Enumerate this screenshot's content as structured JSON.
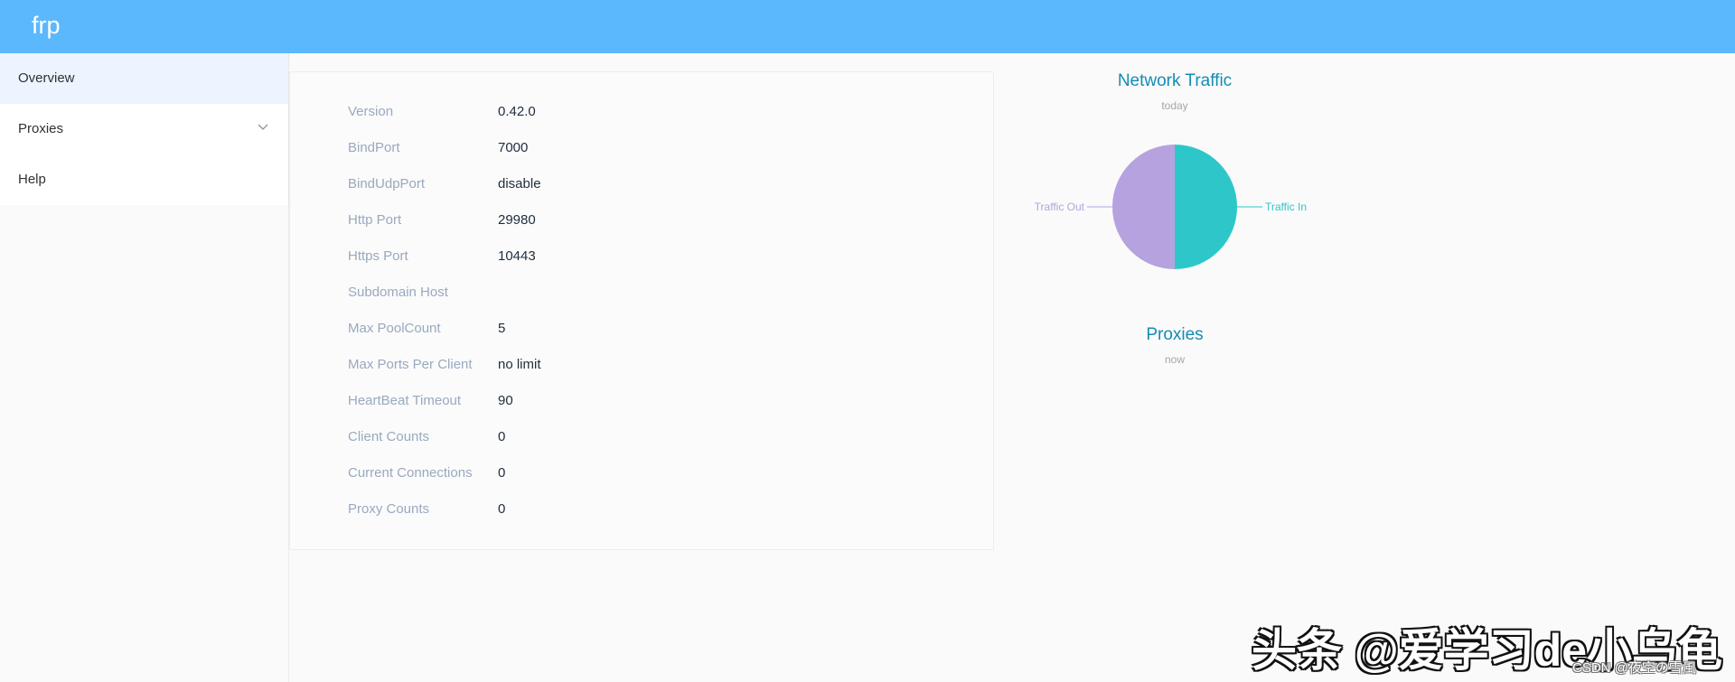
{
  "app": {
    "brand": "frp"
  },
  "sidebar": {
    "items": [
      {
        "label": "Overview",
        "active": true
      },
      {
        "label": "Proxies",
        "has_submenu": true
      },
      {
        "label": "Help"
      }
    ]
  },
  "server_info": [
    {
      "label": "Version",
      "value": "0.42.0"
    },
    {
      "label": "BindPort",
      "value": "7000"
    },
    {
      "label": "BindUdpPort",
      "value": "disable"
    },
    {
      "label": "Http Port",
      "value": "29980"
    },
    {
      "label": "Https Port",
      "value": "10443"
    },
    {
      "label": "Subdomain Host",
      "value": ""
    },
    {
      "label": "Max PoolCount",
      "value": "5"
    },
    {
      "label": "Max Ports Per Client",
      "value": "no limit"
    },
    {
      "label": "HeartBeat Timeout",
      "value": "90"
    },
    {
      "label": "Client Counts",
      "value": "0"
    },
    {
      "label": "Current Connections",
      "value": "0"
    },
    {
      "label": "Proxy Counts",
      "value": "0"
    }
  ],
  "traffic_chart": {
    "title": "Network Traffic",
    "subtitle": "today"
  },
  "proxies_chart": {
    "title": "Proxies",
    "subtitle": "now"
  },
  "chart_data": {
    "type": "pie",
    "title": "Network Traffic",
    "subtitle": "today",
    "categories": [
      "Traffic In",
      "Traffic Out"
    ],
    "values": [
      50,
      50
    ],
    "colors": [
      "#2ec7c9",
      "#b6a2de"
    ]
  },
  "colors": {
    "header": "#5cb8fd",
    "active_menu_bg": "#ecf5ff",
    "chart_title": "#138cb6",
    "traffic_in": "#2ec7c9",
    "traffic_out": "#b6a2de"
  },
  "watermark": {
    "main": "头条 @爱学习de小乌龟",
    "sub": "CSDN @夜空の雪風"
  }
}
